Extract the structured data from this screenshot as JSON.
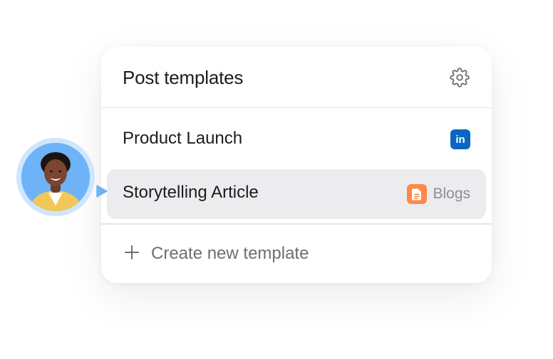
{
  "card": {
    "title": "Post templates",
    "settings_icon": "gear-icon"
  },
  "templates": [
    {
      "label": "Product Launch",
      "channel_icon": "linkedin-icon",
      "channel_badge_text": "in",
      "channel_color": "#0a66c2",
      "selected": false
    },
    {
      "label": "Storytelling Article",
      "channel_icon": "document-icon",
      "channel_label": "Blogs",
      "channel_color": "#fb8a4a",
      "selected": true
    }
  ],
  "create": {
    "icon": "plus-icon",
    "label": "Create new template"
  },
  "user": {
    "avatar_icon": "user-avatar",
    "ring_color": "#6eb3f7"
  },
  "colors": {
    "selected_row_bg": "#ececee",
    "divider": "#e4e4e7",
    "text_primary": "#1c1c1e",
    "text_secondary": "#6e6e73"
  }
}
